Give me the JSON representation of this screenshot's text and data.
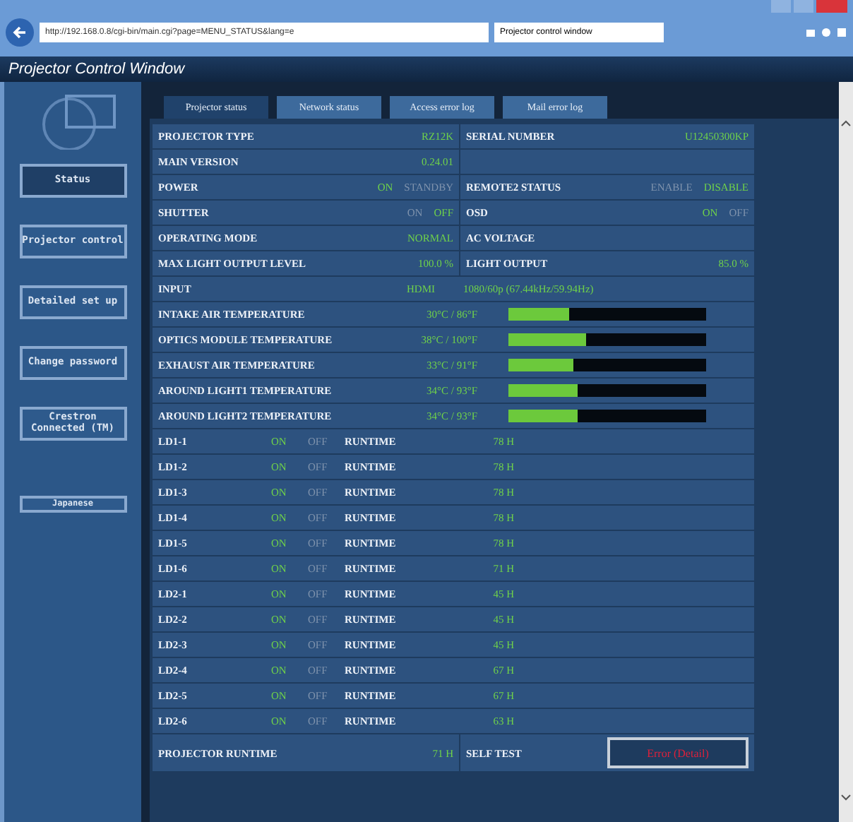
{
  "browser": {
    "address": "http://192.168.0.8/cgi-bin/main.cgi?page=MENU_STATUS&lang=e",
    "tab_title": "Projector control window"
  },
  "window": {
    "title": "Projector Control Window"
  },
  "sidebar": {
    "items": [
      {
        "label": "Status",
        "selected": true
      },
      {
        "label": "Projector control",
        "selected": false
      },
      {
        "label": "Detailed set up",
        "selected": false
      },
      {
        "label": "Change password",
        "selected": false
      },
      {
        "label": "Crestron Connected (TM)",
        "selected": false
      }
    ],
    "language": "Japanese"
  },
  "tabs": [
    {
      "label": "Projector status",
      "selected": true
    },
    {
      "label": "Network status",
      "selected": false
    },
    {
      "label": "Access error log",
      "selected": false
    },
    {
      "label": "Mail error log",
      "selected": false
    }
  ],
  "status_rows": [
    {
      "left": {
        "kind": "value",
        "label": "PROJECTOR TYPE",
        "value": "RZ12K"
      },
      "right": {
        "kind": "value",
        "label": "SERIAL NUMBER",
        "value": "U12450300KP"
      }
    },
    {
      "left": {
        "kind": "value",
        "label": "MAIN VERSION",
        "value": "0.24.01"
      },
      "right": {
        "kind": "empty"
      }
    },
    {
      "left": {
        "kind": "toggle",
        "label": "POWER",
        "options": [
          {
            "label": "ON",
            "selected": true
          },
          {
            "label": "STANDBY",
            "selected": false
          }
        ]
      },
      "right": {
        "kind": "toggle",
        "label": "REMOTE2 STATUS",
        "options": [
          {
            "label": "ENABLE",
            "selected": false
          },
          {
            "label": "DISABLE",
            "selected": true
          }
        ]
      }
    },
    {
      "left": {
        "kind": "toggle",
        "label": "SHUTTER",
        "options": [
          {
            "label": "ON",
            "selected": false
          },
          {
            "label": "OFF",
            "selected": true
          }
        ]
      },
      "right": {
        "kind": "toggle",
        "label": "OSD",
        "options": [
          {
            "label": "ON",
            "selected": true
          },
          {
            "label": "OFF",
            "selected": false
          }
        ]
      }
    },
    {
      "left": {
        "kind": "value",
        "label": "OPERATING MODE",
        "value": "NORMAL"
      },
      "right": {
        "kind": "value",
        "label": "AC VOLTAGE"
      }
    },
    {
      "left": {
        "kind": "value",
        "label": "MAX LIGHT OUTPUT LEVEL",
        "value": "100.0 %"
      },
      "right": {
        "kind": "value",
        "label": "LIGHT OUTPUT",
        "value": "85.0 %"
      }
    }
  ],
  "input": {
    "label": "INPUT",
    "source": "HDMI",
    "signal": "1080/60p (67.44kHz/59.94Hz)"
  },
  "temperatures": [
    {
      "label": "INTAKE AIR TEMPERATURE",
      "reading": "30°C / 86°F",
      "level": 0.31
    },
    {
      "label": "OPTICS MODULE TEMPERATURE",
      "reading": "38°C / 100°F",
      "level": 0.39
    },
    {
      "label": "EXHAUST AIR TEMPERATURE",
      "reading": "33°C / 91°F",
      "level": 0.33
    },
    {
      "label": "AROUND LIGHT1 TEMPERATURE",
      "reading": "34°C / 93°F",
      "level": 0.35
    },
    {
      "label": "AROUND LIGHT2 TEMPERATURE",
      "reading": "34°C / 93°F",
      "level": 0.35
    }
  ],
  "light_sources": [
    {
      "label": "LD1-1",
      "options": [
        {
          "label": "ON",
          "selected": true
        },
        {
          "label": "OFF",
          "selected": false
        }
      ],
      "runtime_label": "RUNTIME",
      "runtime": "78 H"
    },
    {
      "label": "LD1-2",
      "options": [
        {
          "label": "ON",
          "selected": true
        },
        {
          "label": "OFF",
          "selected": false
        }
      ],
      "runtime_label": "RUNTIME",
      "runtime": "78 H"
    },
    {
      "label": "LD1-3",
      "options": [
        {
          "label": "ON",
          "selected": true
        },
        {
          "label": "OFF",
          "selected": false
        }
      ],
      "runtime_label": "RUNTIME",
      "runtime": "78 H"
    },
    {
      "label": "LD1-4",
      "options": [
        {
          "label": "ON",
          "selected": true
        },
        {
          "label": "OFF",
          "selected": false
        }
      ],
      "runtime_label": "RUNTIME",
      "runtime": "78 H"
    },
    {
      "label": "LD1-5",
      "options": [
        {
          "label": "ON",
          "selected": true
        },
        {
          "label": "OFF",
          "selected": false
        }
      ],
      "runtime_label": "RUNTIME",
      "runtime": "78 H"
    },
    {
      "label": "LD1-6",
      "options": [
        {
          "label": "ON",
          "selected": true
        },
        {
          "label": "OFF",
          "selected": false
        }
      ],
      "runtime_label": "RUNTIME",
      "runtime": "71 H"
    },
    {
      "label": "LD2-1",
      "options": [
        {
          "label": "ON",
          "selected": true
        },
        {
          "label": "OFF",
          "selected": false
        }
      ],
      "runtime_label": "RUNTIME",
      "runtime": "45 H"
    },
    {
      "label": "LD2-2",
      "options": [
        {
          "label": "ON",
          "selected": true
        },
        {
          "label": "OFF",
          "selected": false
        }
      ],
      "runtime_label": "RUNTIME",
      "runtime": "45 H"
    },
    {
      "label": "LD2-3",
      "options": [
        {
          "label": "ON",
          "selected": true
        },
        {
          "label": "OFF",
          "selected": false
        }
      ],
      "runtime_label": "RUNTIME",
      "runtime": "45 H"
    },
    {
      "label": "LD2-4",
      "options": [
        {
          "label": "ON",
          "selected": true
        },
        {
          "label": "OFF",
          "selected": false
        }
      ],
      "runtime_label": "RUNTIME",
      "runtime": "67 H"
    },
    {
      "label": "LD2-5",
      "options": [
        {
          "label": "ON",
          "selected": true
        },
        {
          "label": "OFF",
          "selected": false
        }
      ],
      "runtime_label": "RUNTIME",
      "runtime": "67 H"
    },
    {
      "label": "LD2-6",
      "options": [
        {
          "label": "ON",
          "selected": true
        },
        {
          "label": "OFF",
          "selected": false
        }
      ],
      "runtime_label": "RUNTIME",
      "runtime": "63 H"
    }
  ],
  "footer": {
    "runtime_label": "PROJECTOR RUNTIME",
    "runtime": "71 H",
    "self_test_label": "SELF TEST",
    "self_test_link": "Error (Detail)"
  }
}
